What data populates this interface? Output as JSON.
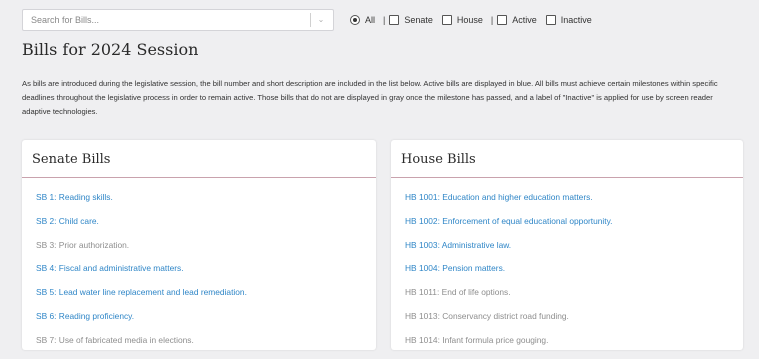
{
  "filters": {
    "search_placeholder": "Search for Bills...",
    "all_label": "All",
    "pipe1": "|",
    "senate_label": "Senate",
    "house_label": "House",
    "pipe2": "|",
    "active_label": "Active",
    "inactive_label": "Inactive",
    "selected": "All"
  },
  "page": {
    "title": "Bills for 2024 Session",
    "intro": "As bills are introduced during the legislative session, the bill number and short description are included in the list below. Active bills are displayed in blue. All bills must achieve certain milestones within specific deadlines throughout the legislative process in order to remain active. Those bills that do not are displayed in gray once the milestone has passed, and a label of \"Inactive\" is applied for use by screen reader adaptive technologies."
  },
  "colors": {
    "active": "#2f86c7",
    "inactive": "#8e8e8e",
    "accent_rule": "#c9a2ad"
  },
  "senate": {
    "title": "Senate Bills",
    "bills": [
      {
        "text": "SB 1: Reading skills.",
        "status": "active"
      },
      {
        "text": "SB 2: Child care.",
        "status": "active"
      },
      {
        "text": "SB 3: Prior authorization.",
        "status": "inactive"
      },
      {
        "text": "SB 4: Fiscal and administrative matters.",
        "status": "active"
      },
      {
        "text": "SB 5: Lead water line replacement and lead remediation.",
        "status": "active"
      },
      {
        "text": "SB 6: Reading proficiency.",
        "status": "active"
      },
      {
        "text": "SB 7: Use of fabricated media in elections.",
        "status": "inactive"
      }
    ]
  },
  "house": {
    "title": "House Bills",
    "bills": [
      {
        "text": "HB 1001: Education and higher education matters.",
        "status": "active"
      },
      {
        "text": "HB 1002: Enforcement of equal educational opportunity.",
        "status": "active"
      },
      {
        "text": "HB 1003: Administrative law.",
        "status": "active"
      },
      {
        "text": "HB 1004: Pension matters.",
        "status": "active"
      },
      {
        "text": "HB 1011: End of life options.",
        "status": "inactive"
      },
      {
        "text": "HB 1013: Conservancy district road funding.",
        "status": "inactive"
      },
      {
        "text": "HB 1014: Infant formula price gouging.",
        "status": "inactive"
      }
    ]
  }
}
